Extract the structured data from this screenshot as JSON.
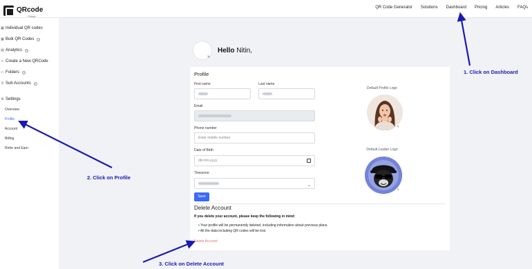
{
  "brand": {
    "name": "QRcode",
    "sub": "Chimp"
  },
  "nav": [
    "QR Code Generator",
    "Solutions",
    "Dashboard",
    "Pricing",
    "Articles",
    "FAQs"
  ],
  "sidebar": {
    "items": [
      {
        "icon": "▦",
        "label": "Individual QR codes",
        "help": false
      },
      {
        "icon": "▦",
        "label": "Bulk QR Codes",
        "help": true
      },
      {
        "icon": "▤",
        "label": "Analytics",
        "help": true
      },
      {
        "icon": "+",
        "label": "Create a New QRCode",
        "help": false
      },
      {
        "icon": "▭",
        "label": "Folders",
        "help": true
      },
      {
        "icon": "⚲",
        "label": "Sub Accounts",
        "help": true
      },
      {
        "icon": "⚙",
        "label": "Settings",
        "help": false
      }
    ],
    "subitems": [
      "Overview",
      "Profile",
      "Account",
      "Billing",
      "Refer and Earn"
    ]
  },
  "greeting": {
    "hello": "Hello",
    "name": "Nitin,"
  },
  "profile": {
    "title": "Profile",
    "first_name_label": "First name",
    "last_name_label": "Last name",
    "email_label": "Email",
    "phone_label": "Phone number",
    "phone_placeholder": "Enter mobile number",
    "dob_label": "Date of Birth",
    "dob_placeholder": "dd-mm-yyyy",
    "timezone_label": "Timezone",
    "save_label": "Save",
    "default_profile_logo": "Default Profile Logo",
    "default_loader_logo": "Default Loader Logo"
  },
  "delete": {
    "title": "Delete Account",
    "warning": "If you delete your account, please keep the following in mind:",
    "bullets": [
      "Your profile will be permanently deleted, including information about previous plans.",
      "All the data including QR codes will be lost."
    ],
    "link": "Delete Account"
  },
  "annotations": {
    "dashboard": "1. Click on Dashboard",
    "profile": "2. Click on Profile",
    "delete": "3. Click on Delete Account",
    "color": "#1a1ab0"
  }
}
